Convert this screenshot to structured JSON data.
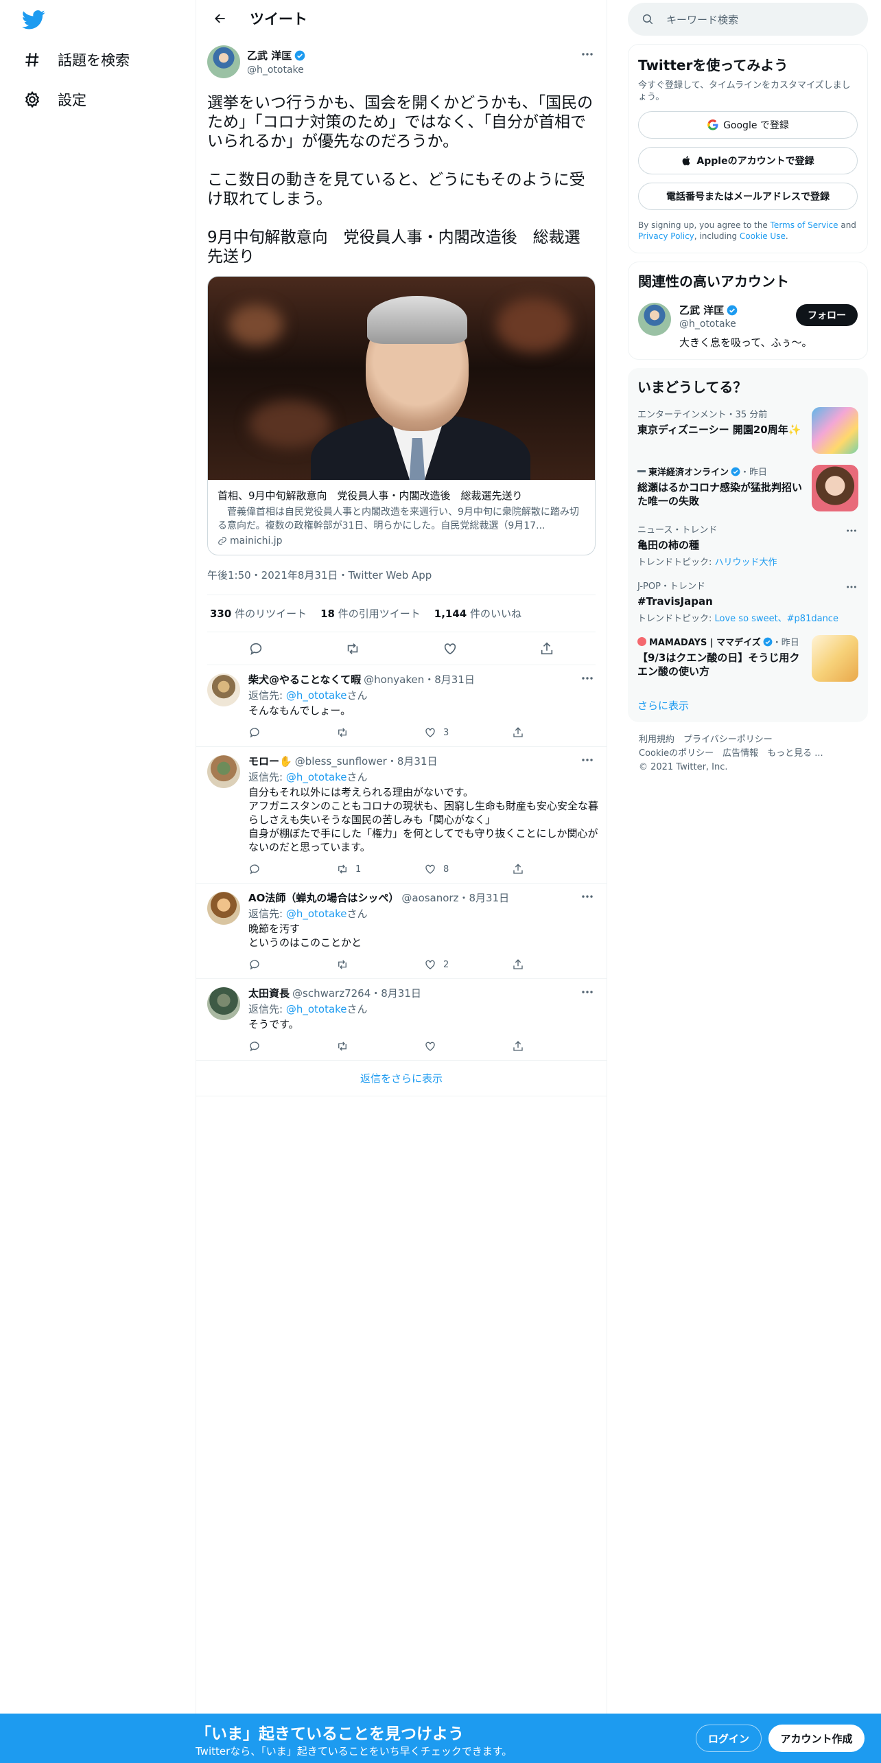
{
  "nav": {
    "explore_label": "話題を検索",
    "settings_label": "設定"
  },
  "header": {
    "title": "ツイート"
  },
  "tweet": {
    "name": "乙武 洋匡",
    "handle": "@h_ototake",
    "text": "選挙をいつ行うかも、国会を開くかどうかも、「国民のため」「コロナ対策のため」ではなく、「自分が首相でいられるか」が優先なのだろうか。\n\nここ数日の動きを見ていると、どうにもそのように受け取れてしまう。\n\n9月中旬解散意向　党役員人事・内閣改造後　総裁選先送り",
    "card": {
      "title": "首相、9月中旬解散意向　党役員人事・内閣改造後　総裁選先送り",
      "desc": "　菅義偉首相は自民党役員人事と内閣改造を来週行い、9月中旬に衆院解散に踏み切る意向だ。複数の政権幹部が31日、明らかにした。自民党総裁選（9月17...",
      "domain": "mainichi.jp"
    },
    "meta": "午後1:50・2021年8月31日・Twitter Web App",
    "retweets": "330",
    "retweets_label": "件のリツイート",
    "quotes": "18",
    "quotes_label": "件の引用ツイート",
    "likes": "1,144",
    "likes_label": "件のいいね"
  },
  "replies": [
    {
      "name": "柴犬@やることなくて暇",
      "handle": "@honyaken",
      "date": "・8月31日",
      "replyto_prefix": "返信先: ",
      "replyto_handle": "@h_ototake",
      "replyto_suffix": "さん",
      "text": "そんなもんでしょー。",
      "reply_count": "",
      "retweet_count": "",
      "like_count": "3"
    },
    {
      "name": "モロー✋",
      "handle": "@bless_sunflower",
      "date": "・8月31日",
      "replyto_prefix": "返信先: ",
      "replyto_handle": "@h_ototake",
      "replyto_suffix": "さん",
      "text": "自分もそれ以外には考えられる理由がないです。\nアフガニスタンのこともコロナの現状も、困窮し生命も財産も安心安全な暮らしさえも失いそうな国民の苦しみも「関心がなく」\n自身が棚ぼたで手にした「権力」を何としてでも守り抜くことにしか関心がないのだと思っています。",
      "reply_count": "",
      "retweet_count": "1",
      "like_count": "8"
    },
    {
      "name": "AO法師（蝉丸の場合はシッペ）",
      "handle": "@aosanorz",
      "date": "・8月31日",
      "replyto_prefix": "返信先: ",
      "replyto_handle": "@h_ototake",
      "replyto_suffix": "さん",
      "text": "晩節を汚す\nというのはこのことかと",
      "reply_count": "",
      "retweet_count": "",
      "like_count": "2"
    },
    {
      "name": "太田資長",
      "handle": "@schwarz7264",
      "date": "・8月31日",
      "replyto_prefix": "返信先: ",
      "replyto_handle": "@h_ototake",
      "replyto_suffix": "さん",
      "text": "そうです。",
      "reply_count": "",
      "retweet_count": "",
      "like_count": ""
    }
  ],
  "show_more_replies": "返信をさらに表示",
  "right": {
    "search_placeholder": "キーワード検索",
    "signup": {
      "title": "Twitterを使ってみよう",
      "subtitle": "今すぐ登録して、タイムラインをカスタマイズしましょう。",
      "google": "Google で登録",
      "apple": "Appleのアカウントで登録",
      "phone": "電話番号またはメールアドレスで登録",
      "terms_prefix": "By signing up, you agree to the ",
      "terms_link": "Terms of Service",
      "terms_and": " and ",
      "privacy_link": "Privacy Policy",
      "including": ", including ",
      "cookie_link": "Cookie Use",
      "terms_end": "."
    },
    "related": {
      "title": "関連性の高いアカウント",
      "name": "乙武 洋匡",
      "handle": "@h_ototake",
      "bio": "大きく息を吸って、ふぅ〜。",
      "follow": "フォロー"
    },
    "trends": {
      "title": "いまどうしてる？",
      "items": [
        {
          "context": "エンターテインメント・35 分前",
          "name": "東京ディズニーシー 開園20周年✨",
          "topic": ""
        },
        {
          "context": "東洋経済オンライン",
          "context_suffix": "・昨日",
          "name": "総瀬はるかコロナ感染が猛批判招いた唯一の失敗",
          "topic": ""
        },
        {
          "context": "ニュース・トレンド",
          "name": "亀田の柿の種",
          "topic_prefix": "トレンドトピック: ",
          "topic": "ハリウッド大作"
        },
        {
          "context": "J-POP・トレンド",
          "name": "#TravisJapan",
          "topic_prefix": "トレンドトピック: ",
          "topic": "Love so sweet、#p81dance"
        },
        {
          "context": "MAMADAYS | ママデイズ",
          "context_suffix": "・昨日",
          "name": "【9/3はクエン酸の日】そうじ用クエン酸の使い方",
          "topic": ""
        }
      ],
      "show_more": "さらに表示"
    },
    "footer": {
      "line1": "利用規約　プライバシーポリシー",
      "line2": "Cookieのポリシー　広告情報　もっと見る ...",
      "line3": "© 2021 Twitter, Inc."
    }
  },
  "bottom": {
    "title": "「いま」起きていることを見つけよう",
    "subtitle": "Twitterなら、「いま」起きていることをいち早くチェックできます。",
    "login": "ログイン",
    "create": "アカウント作成"
  },
  "colors": {
    "accent": "#1d9bf0",
    "text": "#0f1419",
    "muted": "#536471",
    "border": "#eff3f4"
  }
}
